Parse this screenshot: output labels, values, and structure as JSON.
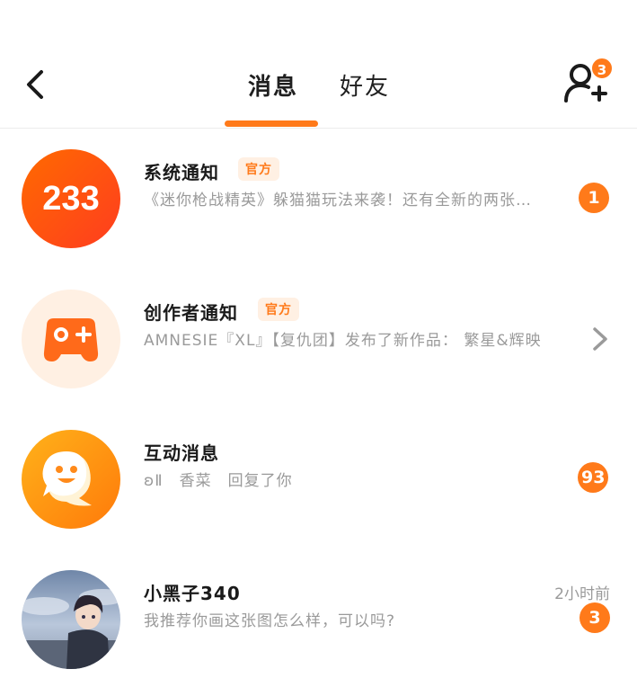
{
  "header": {
    "tabs": [
      {
        "label": "消息",
        "active": true
      },
      {
        "label": "好友",
        "active": false
      }
    ],
    "friend_request_count": "3",
    "accent_color": "#ff7a1a"
  },
  "conversations": [
    {
      "title": "系统通知",
      "tag": "官方",
      "preview": "《迷你枪战精英》躲猫猫玩法来袭！还有全新的两张…",
      "badge": "1",
      "avatar_text": "233",
      "avatar_icon": "233-logo"
    },
    {
      "title": "创作者通知",
      "tag": "官方",
      "preview": "AMNESIE『XL』【复仇团】发布了新作品： 繁星&辉映",
      "avatar_icon": "gamepad-icon",
      "trailing_icon": "chevron-right-icon"
    },
    {
      "title": "互动消息",
      "preview": "ʚⅡ　香菜　回复了你",
      "badge": "93",
      "avatar_icon": "chat-bubble-face-icon"
    },
    {
      "title": "小黑子340",
      "preview": "我推荐你画这张图怎么样，可以吗?",
      "time": "2小时前",
      "badge": "3",
      "avatar_icon": "anime-boy-avatar"
    }
  ]
}
